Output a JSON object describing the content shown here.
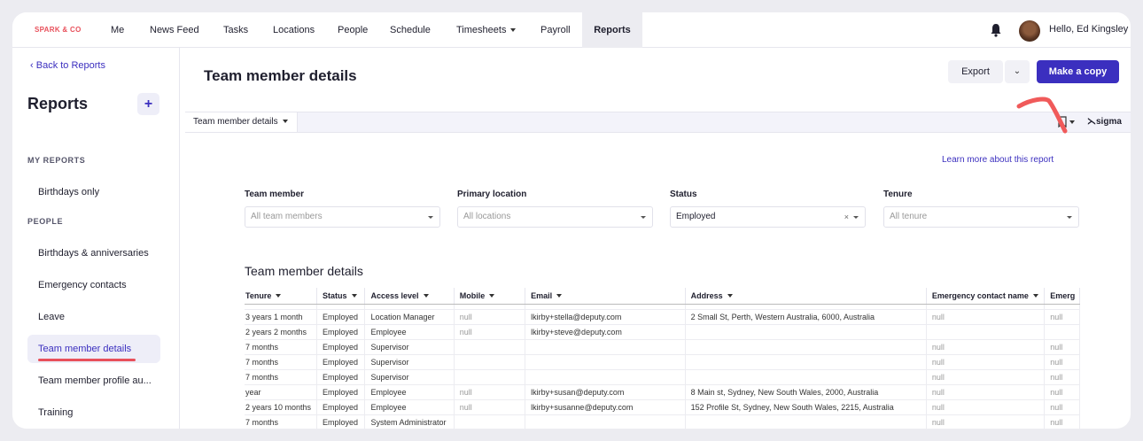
{
  "nav": {
    "brand": "SPARK & CO",
    "items": [
      "Me",
      "News Feed",
      "Tasks",
      "Locations",
      "People",
      "Schedule",
      "Timesheets",
      "Payroll",
      "Reports"
    ],
    "active": "Reports",
    "greeting": "Hello, Ed Kingsley"
  },
  "sidebar": {
    "back": "Back to Reports",
    "title": "Reports",
    "add": "+",
    "sections": [
      {
        "label": "MY REPORTS",
        "items": [
          "Birthdays only"
        ]
      },
      {
        "label": "PEOPLE",
        "items": [
          "Birthdays & anniversaries",
          "Emergency contacts",
          "Leave",
          "Team member details",
          "Team member profile au...",
          "Training"
        ]
      }
    ],
    "active_item": "Team member details"
  },
  "main": {
    "title": "Team member details",
    "export": "Export",
    "make_copy": "Make a copy",
    "tab": "Team member details",
    "sigma": "sigma",
    "learn_more": "Learn more about this report",
    "filters": [
      {
        "label": "Team member",
        "value": "All team members"
      },
      {
        "label": "Primary location",
        "value": "All locations"
      },
      {
        "label": "Status",
        "value": "Employed"
      },
      {
        "label": "Tenure",
        "value": "All tenure"
      }
    ],
    "table_title": "Team member details"
  },
  "table": {
    "columns": [
      "Tenure",
      "Status",
      "Access level",
      "Mobile",
      "Email",
      "Address",
      "Emergency contact name",
      "Emerg"
    ],
    "rows": [
      [
        "3 years 1 month",
        "Employed",
        "Location Manager",
        "null",
        "lkirby+stella@deputy.com",
        "2 Small St, Perth, Western Australia, 6000, Australia",
        "null",
        "null"
      ],
      [
        "2 years 2 months",
        "Employed",
        "Employee",
        "null",
        "lkirby+steve@deputy.com",
        "",
        "",
        ""
      ],
      [
        "7 months",
        "Employed",
        "Supervisor",
        "",
        "",
        "",
        "null",
        "null"
      ],
      [
        "7 months",
        "Employed",
        "Supervisor",
        "",
        "",
        "",
        "null",
        "null"
      ],
      [
        "7 months",
        "Employed",
        "Supervisor",
        "",
        "",
        "",
        "null",
        "null"
      ],
      [
        "year",
        "Employed",
        "Employee",
        "null",
        "lkirby+susan@deputy.com",
        "8 Main st, Sydney, New South Wales, 2000, Australia",
        "null",
        "null"
      ],
      [
        "2 years 10 months",
        "Employed",
        "Employee",
        "null",
        "lkirby+susanne@deputy.com",
        "152 Profile St, Sydney, New South Wales, 2215, Australia",
        "null",
        "null"
      ],
      [
        "7 months",
        "Employed",
        "System Administrator",
        "",
        "",
        "",
        "null",
        "null"
      ]
    ]
  },
  "colors": {
    "accent": "#3b2fbf",
    "brand": "#e8505b",
    "annotation": "#f05a5a"
  }
}
